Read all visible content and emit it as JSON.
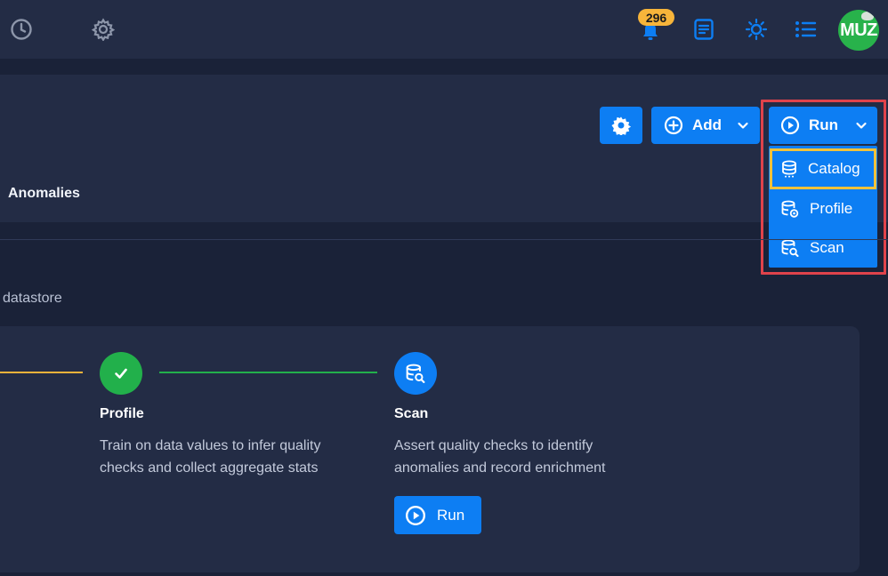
{
  "topbar": {
    "notifications_count": "296",
    "avatar_initials": "MUZ"
  },
  "header": {
    "tab_anomalies": "Anomalies",
    "add_label": "Add",
    "run_label": "Run"
  },
  "run_menu": {
    "items": [
      {
        "label": "Catalog",
        "icon": "database-catalog-icon"
      },
      {
        "label": "Profile",
        "icon": "database-profile-icon"
      },
      {
        "label": "Scan",
        "icon": "database-scan-icon"
      }
    ]
  },
  "main": {
    "subtitle": "datastore",
    "steps": [
      {
        "title": "Profile",
        "description": "Train on data values to infer quality checks and collect aggregate stats",
        "icon": "check-icon",
        "status_color": "#22b04b"
      },
      {
        "title": "Scan",
        "description": "Assert quality checks to identify anomalies and record enrichment",
        "icon": "database-scan-icon",
        "status_color": "#0d7ef3",
        "run_label": "Run"
      }
    ]
  },
  "colors": {
    "accent": "#0d7ef3",
    "success": "#22b04b",
    "progress_line": "#f2b33a",
    "highlight_red": "#e0434b",
    "highlight_yellow": "#f2c23a",
    "badge": "#f7b53a"
  }
}
